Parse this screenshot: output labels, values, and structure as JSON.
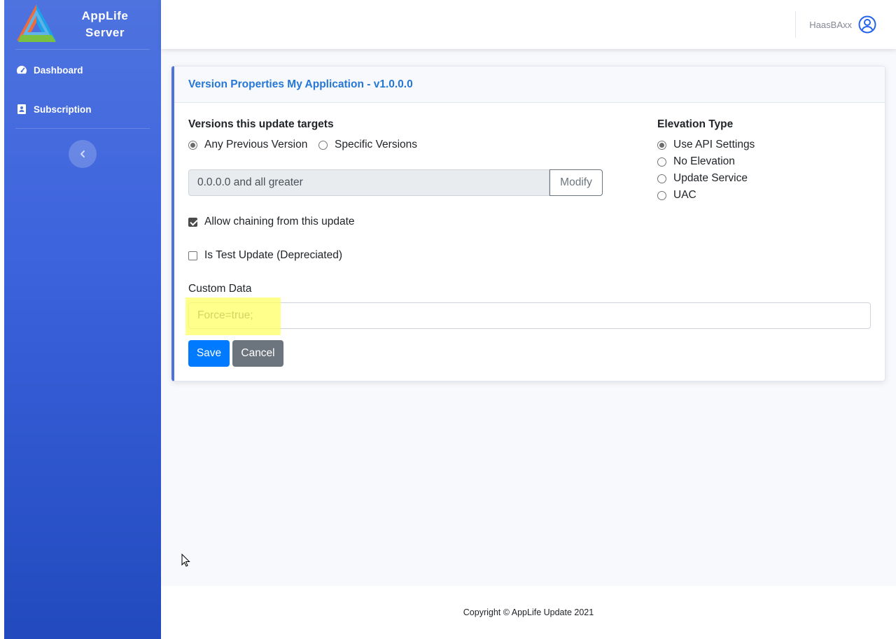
{
  "brand": {
    "line1": "AppLife",
    "line2": "Server"
  },
  "sidebar": {
    "items": [
      {
        "label": "Dashboard",
        "icon": "tachometer-icon"
      },
      {
        "label": "Subscription",
        "icon": "address-book-icon"
      }
    ],
    "toggle_icon": "chevron-left-icon"
  },
  "topbar": {
    "username": "HaasBAxx",
    "user_icon": "user-circle-icon"
  },
  "card": {
    "title": "Version Properties My Application - v1.0.0.0",
    "targets": {
      "label": "Versions this update targets",
      "options": [
        "Any Previous Version",
        "Specific Versions"
      ],
      "selected": "Any Previous Version",
      "range_value": "0.0.0.0 and all greater",
      "modify_label": "Modify"
    },
    "elevation": {
      "label": "Elevation Type",
      "options": [
        "Use API Settings",
        "No Elevation",
        "Update Service",
        "UAC"
      ],
      "selected": "Use API Settings"
    },
    "allow_chaining": {
      "label": "Allow chaining from this update",
      "checked": true
    },
    "test_update": {
      "label": "Is Test Update (Depreciated)",
      "checked": false
    },
    "custom_data": {
      "label": "Custom Data",
      "value": "Force=true;"
    },
    "save_label": "Save",
    "cancel_label": "Cancel"
  },
  "footer": {
    "text": "Copyright © AppLife Update 2021"
  },
  "colors": {
    "sidebar": "#4e73df",
    "primary": "#007bff",
    "secondary": "#6c757d",
    "title": "#2577d6",
    "highlight": "#ffff66"
  }
}
